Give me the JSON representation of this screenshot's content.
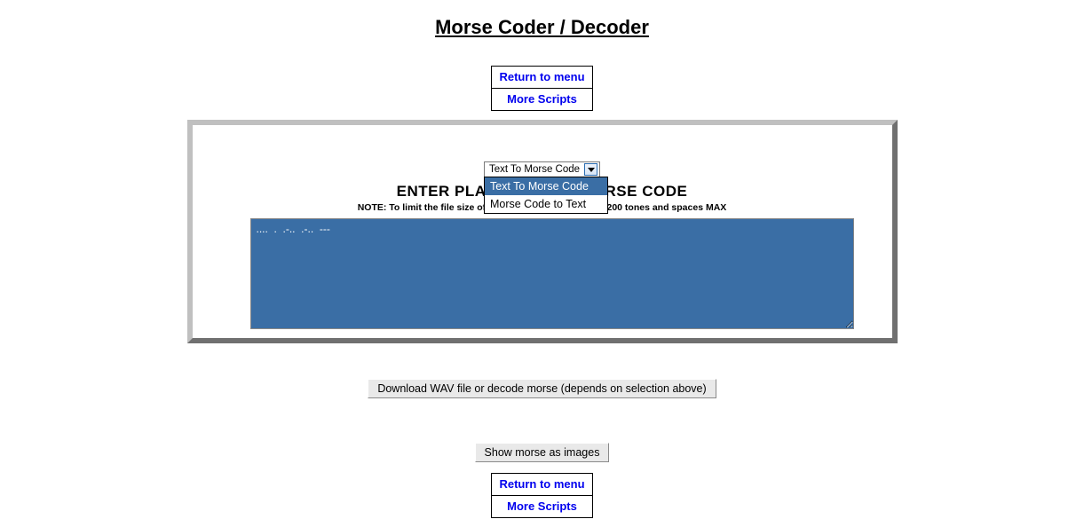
{
  "title": "Morse Coder / Decoder",
  "nav": {
    "return_label": "Return to menu",
    "more_label": "More Scripts"
  },
  "dropdown": {
    "selected_label": "Text To Morse Code",
    "options": [
      "Text To Morse Code",
      "Morse Code to Text"
    ]
  },
  "instruction": "ENTER PLAIN TEXT OR MORSE CODE",
  "note": "NOTE: To limit the file size of the WAV file it is limited to 200 tones and spaces MAX",
  "textarea_value": "....  .  .-..  .-..  ---",
  "buttons": {
    "download": "Download WAV file or decode morse (depends on selection above)",
    "show_images": "Show morse as images"
  }
}
